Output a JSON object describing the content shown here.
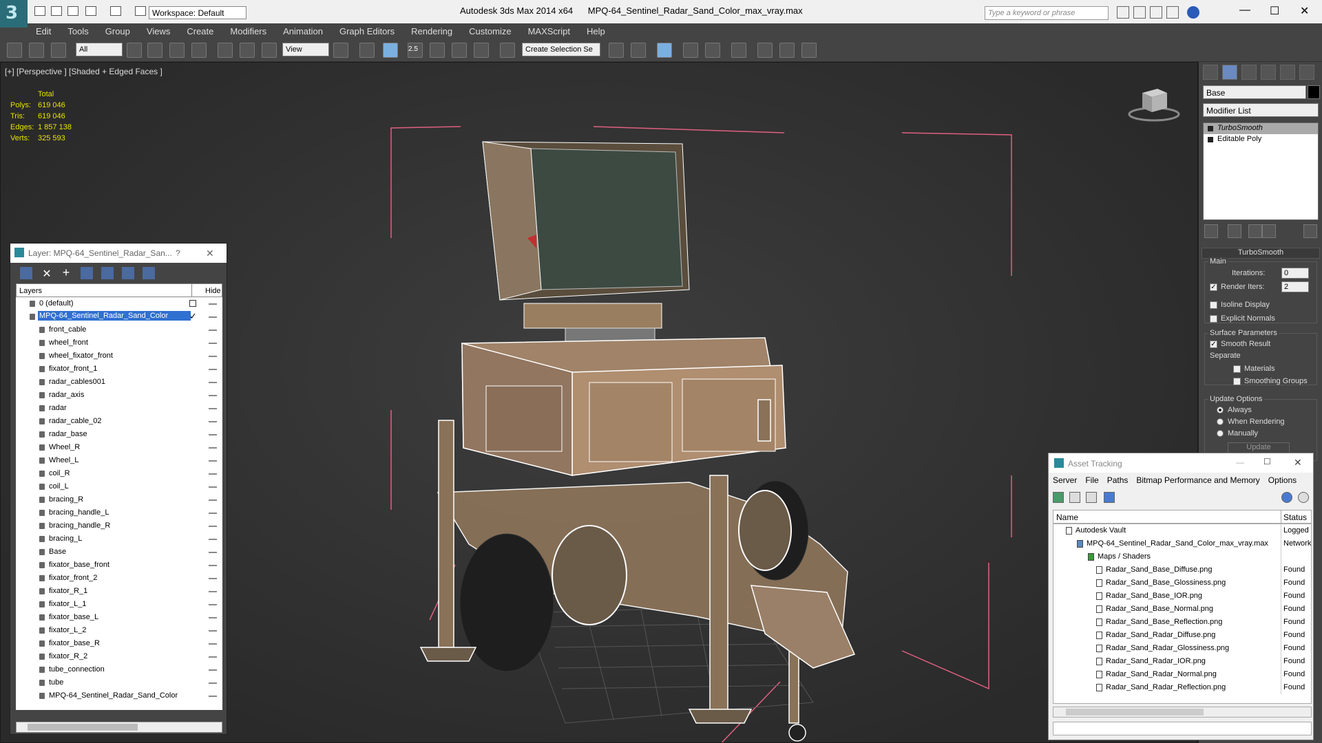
{
  "app": {
    "window_title": "Autodesk 3ds Max  2014 x64",
    "file_title": "MPQ-64_Sentinel_Radar_Sand_Color_max_vray.max",
    "workspace": "Workspace: Default",
    "search_placeholder": "Type a keyword or phrase",
    "logo": "3"
  },
  "menu": [
    "Edit",
    "Tools",
    "Group",
    "Views",
    "Create",
    "Modifiers",
    "Animation",
    "Graph Editors",
    "Rendering",
    "Customize",
    "MAXScript",
    "Help"
  ],
  "toolbar": {
    "selection_filter": "All",
    "ref_coord": "View",
    "named_selection": "Create Selection Se",
    "snap_label": "2.5"
  },
  "viewport": {
    "label": "[+] [Perspective ] [Shaded + Edged Faces ]",
    "stats": {
      "header": "Total",
      "polys_label": "Polys:",
      "polys": "619 046",
      "tris_label": "Tris:",
      "tris": "619 046",
      "edges_label": "Edges:",
      "edges": "1 857 138",
      "verts_label": "Verts:",
      "verts": "325 593"
    }
  },
  "command_panel": {
    "object_name": "Base",
    "modifier_list": "Modifier List",
    "stack": [
      "TurboSmooth",
      "Editable Poly"
    ],
    "turbosmooth": {
      "title": "TurboSmooth",
      "main": "Main",
      "iterations_label": "Iterations:",
      "iterations": "0",
      "render_iters_label": "Render Iters:",
      "render_iters": "2",
      "isoline": "Isoline Display",
      "explicit_normals": "Explicit Normals",
      "surface_params": "Surface Parameters",
      "smooth_result": "Smooth Result",
      "separate": "Separate",
      "materials": "Materials",
      "smoothing_groups": "Smoothing Groups",
      "update_options": "Update Options",
      "always": "Always",
      "when_rendering": "When Rendering",
      "manually": "Manually",
      "update": "Update"
    }
  },
  "layer_panel": {
    "title": "Layer: MPQ-64_Sentinel_Radar_San...",
    "help": "?",
    "close": "✕",
    "col_layers": "Layers",
    "col_hide": "Hide",
    "default_layer": "0 (default)",
    "selected_layer": "MPQ-64_Sentinel_Radar_Sand_Color",
    "objects": [
      "front_cable",
      "wheel_front",
      "wheel_fixator_front",
      "fixator_front_1",
      "radar_cables001",
      "radar_axis",
      "radar",
      "radar_cable_02",
      "radar_base",
      "Wheel_R",
      "Wheel_L",
      "coil_R",
      "coil_L",
      "bracing_R",
      "bracing_handle_L",
      "bracing_handle_R",
      "bracing_L",
      "Base",
      "fixator_base_front",
      "fixator_front_2",
      "fixator_R_1",
      "fixator_L_1",
      "fixator_base_L",
      "fixator_L_2",
      "fixator_base_R",
      "fixator_R_2",
      "tube_connection",
      "tube",
      "MPQ-64_Sentinel_Radar_Sand_Color"
    ]
  },
  "asset_tracking": {
    "title": "Asset Tracking",
    "menu": [
      "Server",
      "File",
      "Paths",
      "Bitmap Performance and Memory",
      "Options"
    ],
    "col_name": "Name",
    "col_status": "Status",
    "rows": [
      {
        "name": "Autodesk Vault",
        "status": "Logged",
        "indent": 0
      },
      {
        "name": "MPQ-64_Sentinel_Radar_Sand_Color_max_vray.max",
        "status": "Network",
        "indent": 1
      },
      {
        "name": "Maps / Shaders",
        "status": "",
        "indent": 2
      },
      {
        "name": "Radar_Sand_Base_Diffuse.png",
        "status": "Found",
        "indent": 3
      },
      {
        "name": "Radar_Sand_Base_Glossiness.png",
        "status": "Found",
        "indent": 3
      },
      {
        "name": "Radar_Sand_Base_IOR.png",
        "status": "Found",
        "indent": 3
      },
      {
        "name": "Radar_Sand_Base_Normal.png",
        "status": "Found",
        "indent": 3
      },
      {
        "name": "Radar_Sand_Base_Reflection.png",
        "status": "Found",
        "indent": 3
      },
      {
        "name": "Radar_Sand_Radar_Diffuse.png",
        "status": "Found",
        "indent": 3
      },
      {
        "name": "Radar_Sand_Radar_Glossiness.png",
        "status": "Found",
        "indent": 3
      },
      {
        "name": "Radar_Sand_Radar_IOR.png",
        "status": "Found",
        "indent": 3
      },
      {
        "name": "Radar_Sand_Radar_Normal.png",
        "status": "Found",
        "indent": 3
      },
      {
        "name": "Radar_Sand_Radar_Reflection.png",
        "status": "Found",
        "indent": 3
      }
    ]
  },
  "colors": {
    "stats": "#e8e400",
    "selection": "#3070d0",
    "bbox": "#e06080",
    "model": "#c8a880"
  }
}
